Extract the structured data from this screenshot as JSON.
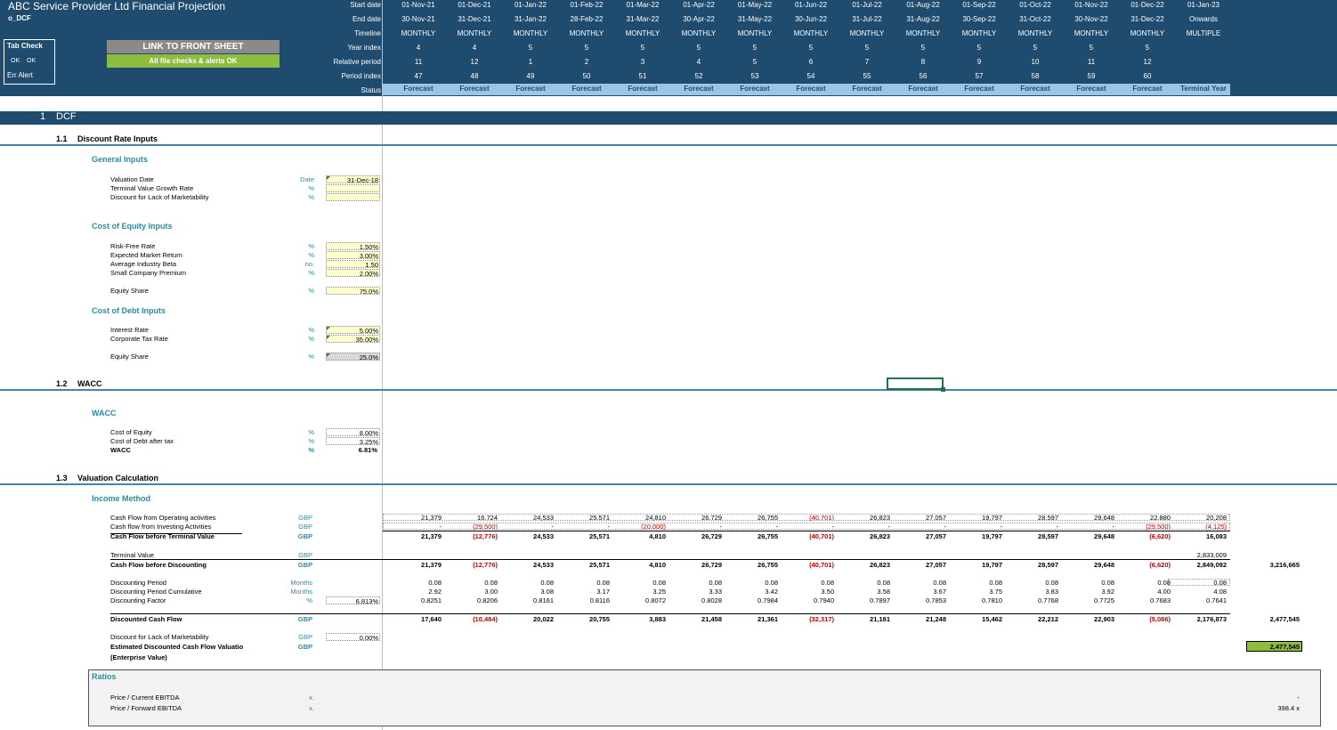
{
  "header": {
    "title": "ABC Service Provider Ltd Financial Projection",
    "sheet": "o_DCF",
    "tab_check": "Tab Check",
    "ok1": "OK",
    "ok2": "OK",
    "err": "Err Alert",
    "link_button": "LINK TO FRONT SHEET",
    "checks_ok": "All file checks & alerts OK",
    "row_labels": {
      "start": "Start date",
      "end": "End date",
      "timeline": "Timeline",
      "year_index": "Year index",
      "relative": "Relative period",
      "period_index": "Period index",
      "status": "Status"
    },
    "columns": [
      {
        "start": "01-Nov-21",
        "end": "30-Nov-21",
        "timeline": "MONTHLY",
        "year": "4",
        "rel": "11",
        "period": "47",
        "status": "Forecast"
      },
      {
        "start": "01-Dec-21",
        "end": "31-Dec-21",
        "timeline": "MONTHLY",
        "year": "4",
        "rel": "12",
        "period": "48",
        "status": "Forecast"
      },
      {
        "start": "01-Jan-22",
        "end": "31-Jan-22",
        "timeline": "MONTHLY",
        "year": "5",
        "rel": "1",
        "period": "49",
        "status": "Forecast"
      },
      {
        "start": "01-Feb-22",
        "end": "28-Feb-22",
        "timeline": "MONTHLY",
        "year": "5",
        "rel": "2",
        "period": "50",
        "status": "Forecast"
      },
      {
        "start": "01-Mar-22",
        "end": "31-Mar-22",
        "timeline": "MONTHLY",
        "year": "5",
        "rel": "3",
        "period": "51",
        "status": "Forecast"
      },
      {
        "start": "01-Apr-22",
        "end": "30-Apr-22",
        "timeline": "MONTHLY",
        "year": "5",
        "rel": "4",
        "period": "52",
        "status": "Forecast"
      },
      {
        "start": "01-May-22",
        "end": "31-May-22",
        "timeline": "MONTHLY",
        "year": "5",
        "rel": "5",
        "period": "53",
        "status": "Forecast"
      },
      {
        "start": "01-Jun-22",
        "end": "30-Jun-22",
        "timeline": "MONTHLY",
        "year": "5",
        "rel": "6",
        "period": "54",
        "status": "Forecast"
      },
      {
        "start": "01-Jul-22",
        "end": "31-Jul-22",
        "timeline": "MONTHLY",
        "year": "5",
        "rel": "7",
        "period": "55",
        "status": "Forecast"
      },
      {
        "start": "01-Aug-22",
        "end": "31-Aug-22",
        "timeline": "MONTHLY",
        "year": "5",
        "rel": "8",
        "period": "56",
        "status": "Forecast"
      },
      {
        "start": "01-Sep-22",
        "end": "30-Sep-22",
        "timeline": "MONTHLY",
        "year": "5",
        "rel": "9",
        "period": "57",
        "status": "Forecast"
      },
      {
        "start": "01-Oct-22",
        "end": "31-Oct-22",
        "timeline": "MONTHLY",
        "year": "5",
        "rel": "10",
        "period": "58",
        "status": "Forecast"
      },
      {
        "start": "01-Nov-22",
        "end": "30-Nov-22",
        "timeline": "MONTHLY",
        "year": "5",
        "rel": "11",
        "period": "59",
        "status": "Forecast"
      },
      {
        "start": "01-Dec-22",
        "end": "31-Dec-22",
        "timeline": "MONTHLY",
        "year": "5",
        "rel": "12",
        "period": "60",
        "status": "Forecast"
      },
      {
        "start": "01-Jan-23",
        "end": "Onwards",
        "timeline": "MULTIPLE",
        "year": "",
        "rel": "",
        "period": "",
        "status": "Terminal Year"
      }
    ]
  },
  "section": {
    "num": "1",
    "title": "DCF"
  },
  "sub11": {
    "num": "1.1",
    "title": "Discount Rate Inputs"
  },
  "general": {
    "title": "General Inputs",
    "valuation_date": {
      "label": "Valuation Date",
      "unit": "Date",
      "value": "31-Dec-18"
    },
    "tv_growth": {
      "label": "Terminal Value Growth Rate",
      "unit": "%",
      "value": ""
    },
    "dlom": {
      "label": "Discount for Lack of Marketability",
      "unit": "%",
      "value": ""
    }
  },
  "equity": {
    "title": "Cost of Equity Inputs",
    "rf": {
      "label": "Risk-Free Rate",
      "unit": "%",
      "value": "1.50%"
    },
    "mkt": {
      "label": "Expected Market Return",
      "unit": "%",
      "value": "3.00%"
    },
    "beta": {
      "label": "Average Industry Beta",
      "unit": "no.",
      "value": "1.50"
    },
    "scp": {
      "label": "Small Company Premium",
      "unit": "%",
      "value": "2.00%"
    },
    "share": {
      "label": "Equity Share",
      "unit": "%",
      "value": "75.0%"
    }
  },
  "debt": {
    "title": "Cost of Debt Inputs",
    "rate": {
      "label": "Interest Rate",
      "unit": "%",
      "value": "5.00%"
    },
    "tax": {
      "label": "Corporate Tax Rate",
      "unit": "%",
      "value": "35.00%"
    },
    "share": {
      "label": "Equity Share",
      "unit": "%",
      "value": "25.0%"
    }
  },
  "sub12": {
    "num": "1.2",
    "title": "WACC"
  },
  "wacc": {
    "title": "WACC",
    "coe": {
      "label": "Cost of Equity",
      "unit": "%",
      "value": "8.00%"
    },
    "cod": {
      "label": "Cost of Debt after tax",
      "unit": "%",
      "value": "3.25%"
    },
    "wacc": {
      "label": "WACC",
      "unit": "%",
      "value": "6.81%"
    }
  },
  "sub13": {
    "num": "1.3",
    "title": "Valuation Calculation"
  },
  "income": {
    "title": "Income Method",
    "rows": [
      {
        "label": "Cash Flow from Operating activities",
        "unit": "GBP",
        "bold": false,
        "left": "",
        "total": "",
        "values": [
          "21,379",
          "16,724",
          "24,533",
          "25,571",
          "24,810",
          "26,729",
          "26,755",
          "(40,701)",
          "26,823",
          "27,057",
          "19,797",
          "28,597",
          "29,648",
          "22,880",
          "20,208"
        ]
      },
      {
        "label": "Cash flow from Investing Activities",
        "unit": "GBP",
        "bold": false,
        "left": "",
        "total": "",
        "values": [
          "-",
          "(29,500)",
          "-",
          "-",
          "(20,000)",
          "-",
          "-",
          "-",
          "-",
          "-",
          "-",
          "-",
          "-",
          "(29,500)",
          "(4,125)"
        ]
      },
      {
        "label": "Cash Flow before Terminal Value",
        "unit": "GBP",
        "bold": true,
        "left": "",
        "total": "",
        "values": [
          "21,379",
          "(12,776)",
          "24,533",
          "25,571",
          "4,810",
          "26,729",
          "26,755",
          "(40,701)",
          "26,823",
          "27,057",
          "19,797",
          "28,597",
          "29,648",
          "(6,620)",
          "16,083"
        ]
      },
      {
        "label": "Terminal Value",
        "unit": "GBP",
        "bold": false,
        "left": "",
        "total": "",
        "values": [
          "",
          "",
          "",
          "",
          "",
          "",
          "",
          "",
          "",
          "",
          "",
          "",
          "",
          "",
          "2,833,009"
        ]
      },
      {
        "label": "Cash Flow before Discounting",
        "unit": "GBP",
        "bold": true,
        "left": "",
        "total": "3,216,665",
        "values": [
          "21,379",
          "(12,776)",
          "24,533",
          "25,571",
          "4,810",
          "26,729",
          "26,755",
          "(40,701)",
          "26,823",
          "27,057",
          "19,797",
          "28,597",
          "29,648",
          "(6,620)",
          "2,849,092"
        ]
      },
      {
        "label": "Discounting Period",
        "unit": "Months",
        "bold": false,
        "left": "",
        "total": "",
        "values": [
          "0.08",
          "0.08",
          "0.08",
          "0.08",
          "0.08",
          "0.08",
          "0.08",
          "0.08",
          "0.08",
          "0.08",
          "0.08",
          "0.08",
          "0.08",
          "0.08",
          "0.08"
        ]
      },
      {
        "label": "Discounting Period Cumulative",
        "unit": "Months",
        "bold": false,
        "left": "",
        "total": "",
        "values": [
          "2.92",
          "3.00",
          "3.08",
          "3.17",
          "3.25",
          "3.33",
          "3.42",
          "3.50",
          "3.58",
          "3.67",
          "3.75",
          "3.83",
          "3.92",
          "4.00",
          "4.08"
        ]
      },
      {
        "label": "Discounting Factor",
        "unit": "%",
        "bold": false,
        "left": "6.813%",
        "total": "",
        "values": [
          "0.8251",
          "0.8206",
          "0.8161",
          "0.8116",
          "0.8072",
          "0.8028",
          "0.7984",
          "0.7940",
          "0.7897",
          "0.7853",
          "0.7810",
          "0.7768",
          "0.7725",
          "0.7683",
          "0.7641"
        ]
      },
      {
        "label": "Discounted Cash Flow",
        "unit": "GBP",
        "bold": true,
        "left": "",
        "total": "2,477,545",
        "values": [
          "17,640",
          "(10,484)",
          "20,022",
          "20,755",
          "3,883",
          "21,458",
          "21,361",
          "(32,317)",
          "21,181",
          "21,248",
          "15,462",
          "22,212",
          "22,903",
          "(5,086)",
          "2,176,873"
        ]
      }
    ],
    "dlom": {
      "label": "Discount for Lack of Marketability",
      "unit": "GBP",
      "value": "0.00%"
    },
    "edcf": {
      "label": "Estimated Discounted Cash Flow Valuatio",
      "label2": "(Enterprise Value)",
      "unit": "GBP",
      "value": "2,477,545"
    }
  },
  "ratios": {
    "title": "Ratios",
    "current": {
      "label": "Price / Current EBITDA",
      "unit": "x.",
      "value": "-"
    },
    "forward": {
      "label": "Price / Forward EBITDA",
      "unit": "x.",
      "value": "398.4 x"
    }
  }
}
